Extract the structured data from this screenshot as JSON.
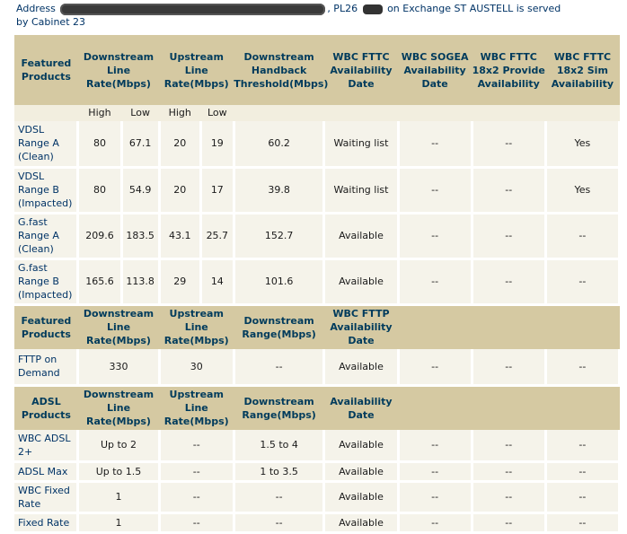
{
  "address": {
    "prefix": "Address",
    "suffix": ", PL26",
    "exchange_text": "on Exchange ST AUSTELL is served",
    "cabinet_text": "by Cabinet 23"
  },
  "fttc_header": {
    "featured_products": "Featured Products",
    "downstream_line_rate": "Downstream Line Rate(Mbps)",
    "upstream_line_rate": "Upstream Line Rate(Mbps)",
    "downstream_handback": "Downstream Handback Threshold(Mbps)",
    "wbc_fttc_availability": "WBC FTTC Availability Date",
    "wbc_sogea_availability": "WBC SOGEA Availability Date",
    "wbc_fttc_18x2_provide": "WBC FTTC 18x2 Provide Availability",
    "wbc_fttc_18x2_sim": "WBC FTTC 18x2 Sim Availability"
  },
  "subheader": {
    "high": "High",
    "low": "Low"
  },
  "fttc_rows": [
    {
      "product": "VDSL Range A (Clean)",
      "down_high": "80",
      "down_low": "67.1",
      "up_high": "20",
      "up_low": "19",
      "handback": "60.2",
      "fttc": "Waiting list",
      "sogea": "--",
      "provide": "--",
      "sim": "Yes"
    },
    {
      "product": "VDSL Range B (Impacted)",
      "down_high": "80",
      "down_low": "54.9",
      "up_high": "20",
      "up_low": "17",
      "handback": "39.8",
      "fttc": "Waiting list",
      "sogea": "--",
      "provide": "--",
      "sim": "Yes"
    },
    {
      "product": "G.fast Range A (Clean)",
      "down_high": "209.6",
      "down_low": "183.5",
      "up_high": "43.1",
      "up_low": "25.7",
      "handback": "152.7",
      "fttc": "Available",
      "sogea": "--",
      "provide": "--",
      "sim": "--"
    },
    {
      "product": "G.fast Range B (Impacted)",
      "down_high": "165.6",
      "down_low": "113.8",
      "up_high": "29",
      "up_low": "14",
      "handback": "101.6",
      "fttc": "Available",
      "sogea": "--",
      "provide": "--",
      "sim": "--"
    }
  ],
  "fttp_header": {
    "featured_products": "Featured Products",
    "downstream_line_rate": "Downstream Line Rate(Mbps)",
    "upstream_line_rate": "Upstream Line Rate(Mbps)",
    "downstream_range": "Downstream Range(Mbps)",
    "wbc_fttp_availability": "WBC FTTP Availability Date"
  },
  "fttp_rows": [
    {
      "product": "FTTP on Demand",
      "down": "330",
      "up": "30",
      "range": "--",
      "avail": "Available",
      "c1": "--",
      "c2": "--",
      "c3": "--"
    }
  ],
  "adsl_header": {
    "adsl_products": "ADSL Products",
    "downstream_line_rate": "Downstream Line Rate(Mbps)",
    "upstream_line_rate": "Upstream Line Rate(Mbps)",
    "downstream_range": "Downstream Range(Mbps)",
    "availability_date": "Availability Date"
  },
  "adsl_rows": [
    {
      "product": "WBC ADSL 2+",
      "down": "Up to 2",
      "up": "--",
      "range": "1.5 to 4",
      "avail": "Available",
      "c1": "--",
      "c2": "--",
      "c3": "--"
    },
    {
      "product": "ADSL Max",
      "down": "Up to 1.5",
      "up": "--",
      "range": "1 to 3.5",
      "avail": "Available",
      "c1": "--",
      "c2": "--",
      "c3": "--"
    },
    {
      "product": "WBC Fixed Rate",
      "down": "1",
      "up": "--",
      "range": "--",
      "avail": "Available",
      "c1": "--",
      "c2": "--",
      "c3": "--"
    },
    {
      "product": "Fixed Rate",
      "down": "1",
      "up": "--",
      "range": "--",
      "avail": "Available",
      "c1": "--",
      "c2": "--",
      "c3": "--"
    }
  ]
}
